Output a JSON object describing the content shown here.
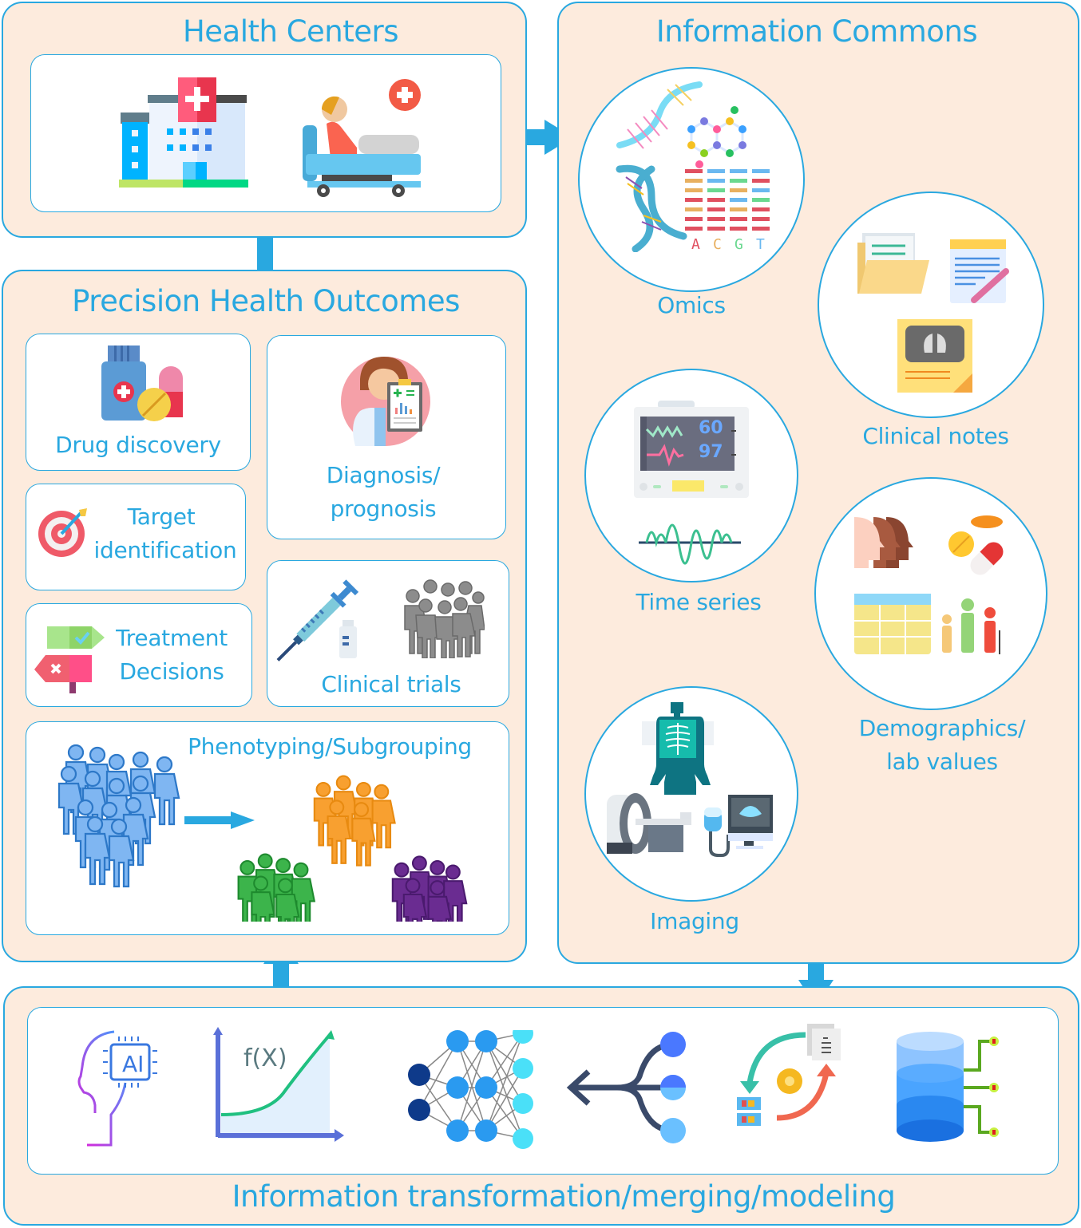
{
  "health_centers": {
    "title": "Health Centers",
    "icons": [
      "hospital-building-icon",
      "patient-bed-icon"
    ]
  },
  "precision_health_outcomes": {
    "title": "Precision Health Outcomes",
    "items": [
      {
        "label": "Drug discovery",
        "icon": "medicine-bottle-pills-icon"
      },
      {
        "label_line1": "Diagnosis/",
        "label_line2": "prognosis",
        "icon": "doctor-clipboard-icon"
      },
      {
        "label_line1": "Target",
        "label_line2": "identification",
        "icon": "target-dart-icon"
      },
      {
        "label_line1": "Treatment",
        "label_line2": "Decisions",
        "icon": "signpost-check-cross-icon"
      },
      {
        "label": "Clinical trials",
        "icon": "syringe-vial-group-icon"
      },
      {
        "label": "Phenotyping/Subgrouping",
        "icon": "population-clusters-icon"
      }
    ]
  },
  "information_commons": {
    "title": "Information Commons",
    "sources": [
      {
        "label": "Omics",
        "icon": "dna-molecule-sequence-icon",
        "bases": [
          "A",
          "C",
          "G",
          "T"
        ]
      },
      {
        "label": "Clinical notes",
        "icon": "folder-notes-xray-icon"
      },
      {
        "label": "Time series",
        "icon": "vital-monitor-waveform-icon",
        "readouts": [
          "60",
          "97"
        ]
      },
      {
        "label_line1": "Demographics/",
        "label_line2": "lab values",
        "icon": "heads-pills-table-people-icon"
      },
      {
        "label": "Imaging",
        "icon": "xray-mri-ultrasound-icon"
      }
    ]
  },
  "information_transformation": {
    "title": "Information transformation/merging/modeling",
    "ai_chip_text": "AI",
    "function_text": "f(X)",
    "icons": [
      "ai-head-icon",
      "function-graph-icon",
      "neural-network-icon",
      "merge-arrow-icon",
      "data-processing-cycle-icon",
      "database-icon"
    ]
  },
  "colors": {
    "accent": "#29a8e0",
    "panel_bg": "#fdebdd",
    "card_bg": "#ffffff"
  }
}
